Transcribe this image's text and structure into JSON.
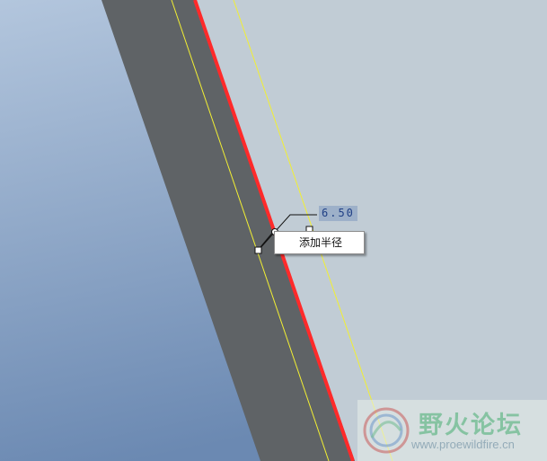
{
  "dimension": {
    "value": "6.50"
  },
  "context_menu": {
    "items": [
      {
        "label": "添加半径"
      }
    ]
  },
  "watermark": {
    "title": "野火论坛",
    "url": "www.proewildfire.cn"
  },
  "colors": {
    "background_left": "#7b97bf",
    "background_right": "#c1ccd5",
    "surface": "#5f6366",
    "selected_edge": "#ff2a2a",
    "guide_line": "#f2ef33",
    "dimension_highlight": "#9db0c9",
    "dimension_text": "#1f3f85"
  }
}
